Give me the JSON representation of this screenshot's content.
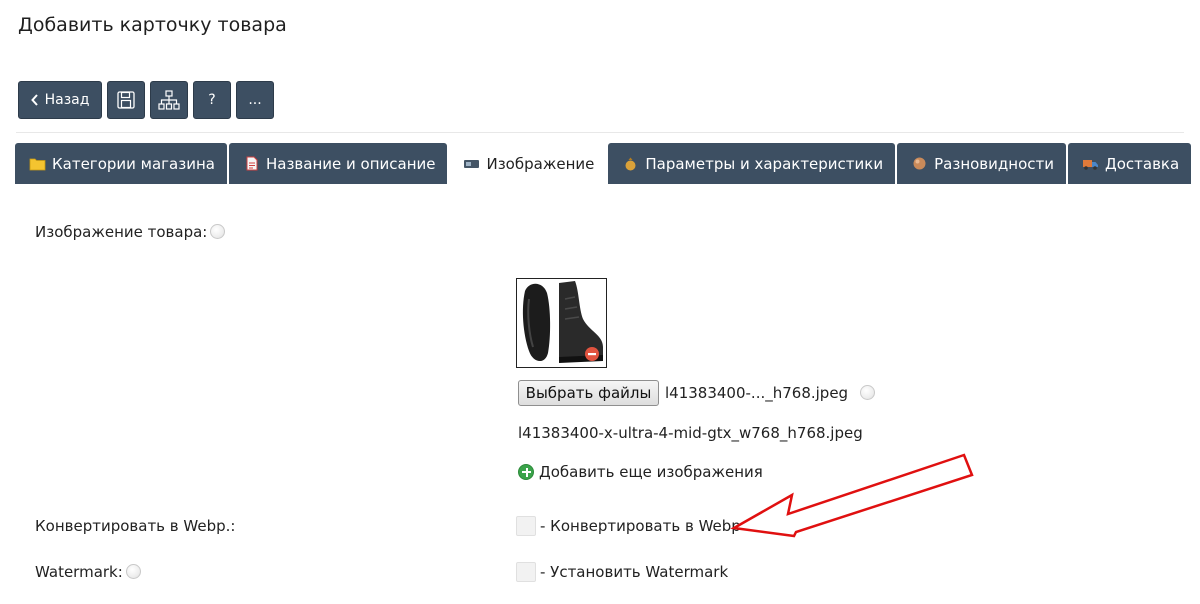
{
  "page": {
    "title": "Добавить карточку товара"
  },
  "toolbar": {
    "back_label": "Назад",
    "help_label": "?",
    "more_label": "..."
  },
  "tabs": [
    {
      "label": "Категории магазина",
      "icon": "folder-icon",
      "active": false
    },
    {
      "label": "Название и описание",
      "icon": "document-icon",
      "active": false
    },
    {
      "label": "Изображение",
      "icon": "image-icon",
      "active": true
    },
    {
      "label": "Параметры и характеристики",
      "icon": "money-bag-icon",
      "active": false
    },
    {
      "label": "Разновидности",
      "icon": "box-icon",
      "active": false
    },
    {
      "label": "Доставка",
      "icon": "truck-icon",
      "active": false
    }
  ],
  "form": {
    "image_label": "Изображение товара:",
    "choose_files_label": "Выбрать файлы",
    "selected_file": "l41383400-..._h768.jpeg",
    "current_file": "l41383400-x-ultra-4-mid-gtx_w768_h768.jpeg",
    "add_more_label": "Добавить еще изображения",
    "webp_label": "Конвертировать в Webp.:",
    "webp_checkbox_label": "- Конвертировать в Webp",
    "webp_checked": false,
    "watermark_label": "Watermark:",
    "watermark_checkbox_label": "- Установить Watermark",
    "watermark_checked": false
  },
  "colors": {
    "tab_bg": "#3d4f62",
    "annotation_arrow": "#e01010",
    "add_icon": "#3aa34a"
  }
}
